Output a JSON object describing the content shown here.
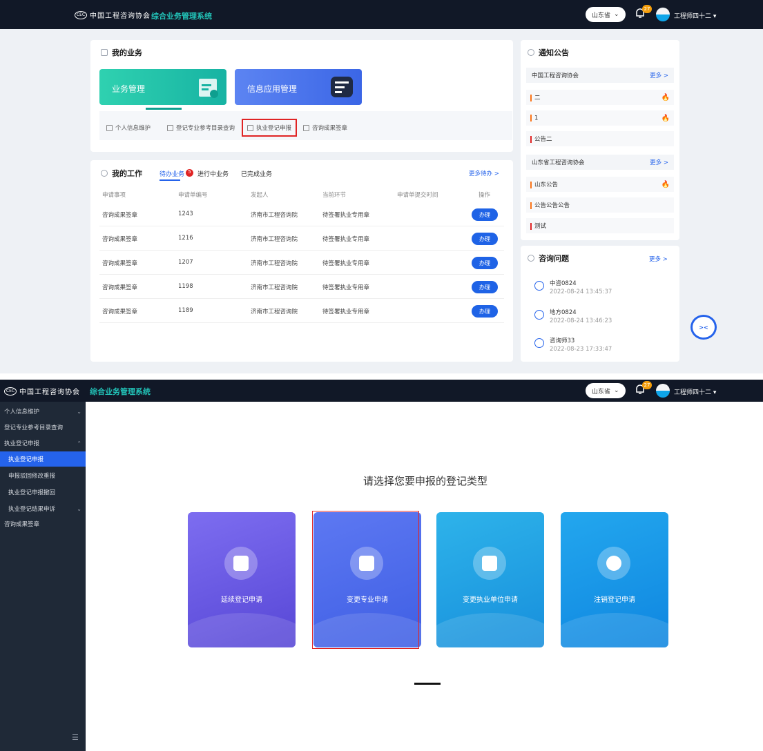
{
  "header": {
    "logo_text": "中国工程咨询协会",
    "system_title": "综合业务管理系统",
    "province": "山东省",
    "notif_count": "27",
    "username": "工程师四十二"
  },
  "my_business": {
    "title": "我的业务",
    "tiles": [
      {
        "label": "业务管理"
      },
      {
        "label": "信息应用管理"
      }
    ],
    "quick_links": [
      {
        "label": "个人信息维护"
      },
      {
        "label": "登记专业参考目录查询"
      },
      {
        "label": "执业登记申报"
      },
      {
        "label": "咨询成果签章"
      }
    ]
  },
  "my_work": {
    "title": "我的工作",
    "tabs": [
      {
        "label": "待办业务",
        "badge": "5"
      },
      {
        "label": "进行中业务"
      },
      {
        "label": "已完成业务"
      }
    ],
    "more": "更多待办 >",
    "columns": [
      "申请事项",
      "申请单编号",
      "发起人",
      "当前环节",
      "申请单提交时间",
      "操作"
    ],
    "rows": [
      {
        "item": "咨询成果签章",
        "no": "1243",
        "initiator": "济南市工程咨询院",
        "step": "待签署执业专用章",
        "time": "",
        "action": "办理"
      },
      {
        "item": "咨询成果签章",
        "no": "1216",
        "initiator": "济南市工程咨询院",
        "step": "待签署执业专用章",
        "time": "",
        "action": "办理"
      },
      {
        "item": "咨询成果签章",
        "no": "1207",
        "initiator": "济南市工程咨询院",
        "step": "待签署执业专用章",
        "time": "",
        "action": "办理"
      },
      {
        "item": "咨询成果签章",
        "no": "1198",
        "initiator": "济南市工程咨询院",
        "step": "待签署执业专用章",
        "time": "",
        "action": "办理"
      },
      {
        "item": "咨询成果签章",
        "no": "1189",
        "initiator": "济南市工程咨询院",
        "step": "待签署执业专用章",
        "time": "",
        "action": "办理"
      }
    ]
  },
  "notices": {
    "title": "通知公告",
    "groups": [
      {
        "org": "中国工程咨询协会",
        "more": "更多 >",
        "items": [
          {
            "text": "二",
            "hot": "🔥"
          },
          {
            "text": "1",
            "hot": "🔥"
          },
          {
            "text": "公告二",
            "hot": ""
          }
        ]
      },
      {
        "org": "山东省工程咨询协会",
        "more": "更多 >",
        "items": [
          {
            "text": "山东公告",
            "hot": "🔥"
          },
          {
            "text": "公告公告公告",
            "hot": ""
          },
          {
            "text": "测试",
            "hot": ""
          }
        ]
      }
    ]
  },
  "consult": {
    "title": "咨询问题",
    "more": "更多 >",
    "items": [
      {
        "name": "中咨0824",
        "time": "2022-08-24 13:45:37"
      },
      {
        "name": "地方0824",
        "time": "2022-08-24 13:46:23"
      },
      {
        "name": "咨询师33",
        "time": "2022-08-23 17:33:47"
      }
    ]
  },
  "sidebar": {
    "items": [
      {
        "label": "个人信息维护",
        "chev": "⌄"
      },
      {
        "label": "登记专业参考目录查询",
        "chev": ""
      },
      {
        "label": "执业登记申报",
        "chev": "⌃"
      },
      {
        "label": "执业登记申报",
        "chev": ""
      },
      {
        "label": "申报驳回修改重报",
        "chev": ""
      },
      {
        "label": "执业登记申报撤回",
        "chev": ""
      },
      {
        "label": "执业登记结果申诉",
        "chev": "⌄"
      },
      {
        "label": "咨询成果签章",
        "chev": ""
      }
    ]
  },
  "register": {
    "prompt": "请选择您要申报的登记类型",
    "types": [
      {
        "label": "延续登记申请",
        "color": "#6c5ce7"
      },
      {
        "label": "变更专业申请",
        "color": "#4f6ef0"
      },
      {
        "label": "变更执业单位申请",
        "color": "#1aa0e6"
      },
      {
        "label": "注销登记申请",
        "color": "#1590e8"
      }
    ]
  },
  "robot_label": "><"
}
